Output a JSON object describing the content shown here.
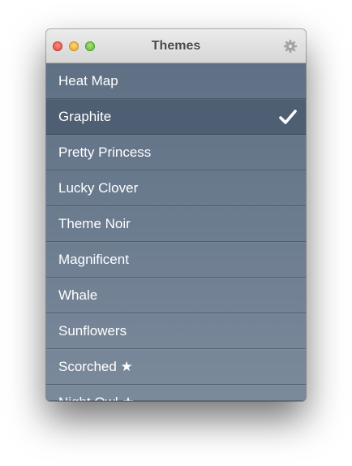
{
  "window": {
    "title": "Themes"
  },
  "themes": [
    {
      "label": "Heat Map",
      "selected": false
    },
    {
      "label": "Graphite",
      "selected": true
    },
    {
      "label": "Pretty Princess",
      "selected": false
    },
    {
      "label": "Lucky Clover",
      "selected": false
    },
    {
      "label": "Theme Noir",
      "selected": false
    },
    {
      "label": "Magnificent",
      "selected": false
    },
    {
      "label": "Whale",
      "selected": false
    },
    {
      "label": "Sunflowers",
      "selected": false
    },
    {
      "label": "Scorched ★",
      "selected": false
    },
    {
      "label": "Night Owl ★",
      "selected": false
    }
  ],
  "icons": {
    "settings": "gear-icon",
    "selected_marker": "checkmark-icon"
  },
  "colors": {
    "list_background": "#66778c",
    "selected_row": "#4e5e73",
    "text": "#ffffff"
  }
}
